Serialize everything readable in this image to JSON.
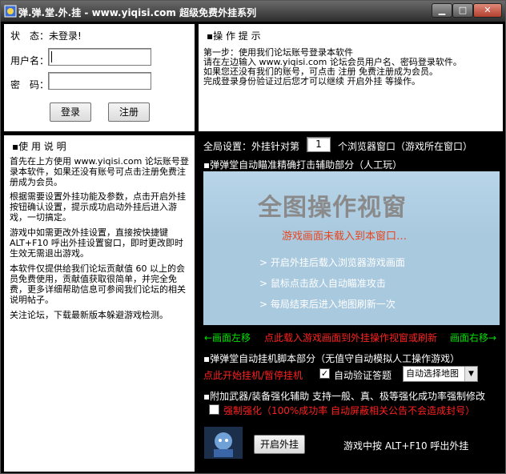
{
  "window": {
    "title": "弹.弹.堂.外.挂 - www.yiqisi.com 超级免费外挂系列",
    "controls": {
      "minimize": "▁",
      "maximize": "□",
      "close": "✕"
    }
  },
  "login": {
    "status_label": "状　态：",
    "status_value": "未登录!",
    "username_label": "用户名：",
    "username_value": "",
    "password_label": "密　码：",
    "password_value": "",
    "login_button": "登录",
    "register_button": "注册"
  },
  "tips": {
    "heading": "▪操 作 提 示",
    "lines": [
      "第一步：使用我们论坛账号登录本软件",
      "请在左边输入 www.yiqisi.com 论坛会员用户名、密码登录软件。",
      "如果您还没有我们的账号，可点击 注册 免费注册成为会员。",
      "完成登录身份验证过后您才可以继续 开启外挂 等操作。"
    ]
  },
  "usage": {
    "heading": "▪使 用 说 明",
    "paragraphs": [
      "首先在上方使用 www.yiqisi.com 论坛账号登录本软件，如果还没有账号可点击注册免费注册成为会员。",
      "根据需要设置外挂功能及参数，点击开启外挂按钮确认设置，提示成功启动外挂后进入游戏，一切搞定。",
      "游戏中如需更改外挂设置，直接按快捷键 ALT+F10 呼出外挂设置窗口，即时更改即时生效无需退出游戏。",
      "本软件仅提供给我们论坛贡献值 60 以上的会员免费使用，贡献值获取很简单，并完全免费，更多详细帮助信息可参阅我们论坛的相关说明帖子。",
      "关注论坛，下载最新版本躲避游戏检测。"
    ]
  },
  "global": {
    "label_before": "全局设置：外挂针对第",
    "window_number": "1",
    "label_after": "个浏览器窗口（游戏所在窗口）"
  },
  "aim": {
    "heading": "▪弹弹堂自动瞄准精确打击辅助部分（人工玩）",
    "preview_title": "全图操作视窗",
    "preview_subtitle": "游戏画面未载入到本窗口…",
    "preview_steps": [
      "> 开启外挂后载入浏览器游戏画面",
      "> 鼠标点击敌人自动瞄准攻击",
      "> 每局结束后进入地图刷新一次"
    ],
    "nav_left": "←画面左移",
    "nav_center": "点此载入游戏画面到外挂操作视窗或刷新",
    "nav_right": "画面右移→"
  },
  "auto": {
    "heading": "▪弹弹堂自动挂机脚本部分（无值守自动模拟人工操作游戏）",
    "start_stop": "点此开始挂机/暂停挂机",
    "verify_label": "自动验证答题",
    "verify_checked": true,
    "map_select": "自动选择地图"
  },
  "enhance": {
    "heading": "▪附加武器/装备强化辅助 支持一般、真、极等强化成功率强制修改",
    "force_label": "强制强化（100%成功率 自动屏蔽相关公告不会造成封号）",
    "force_checked": false
  },
  "bottom": {
    "start_button": "开启外挂",
    "hotkey_hint": "游戏中按 ALT+F10 呼出外挂"
  },
  "colors": {
    "title_bg": "#3a3a3a",
    "green_text": "#00e000",
    "red_text": "#ff2020",
    "preview_bg": "#a9c9df",
    "preview_title": "#8a8a8a",
    "preview_subtitle": "#e8451e"
  }
}
